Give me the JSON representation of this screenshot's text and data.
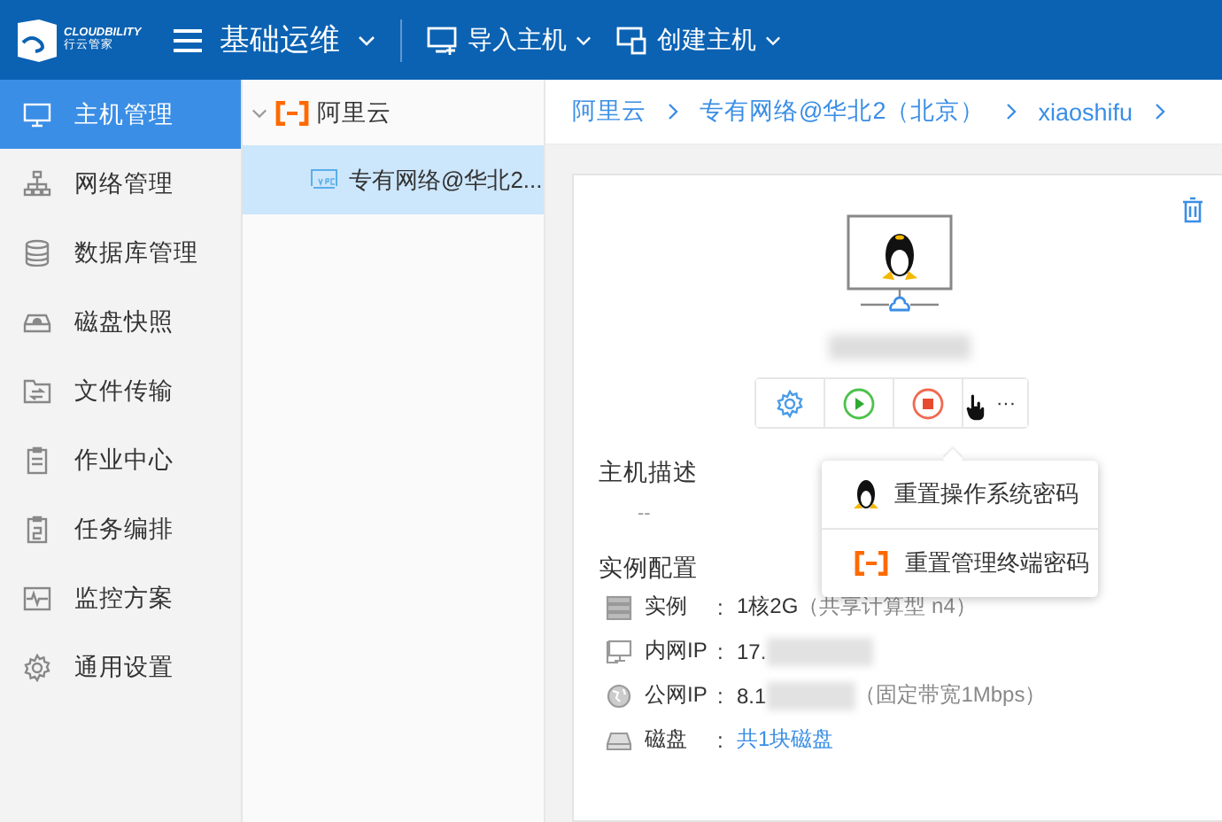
{
  "header": {
    "logo_text": "CLOUDBILITY",
    "logo_subtext": "行云管家",
    "title": "基础运维",
    "actions": [
      {
        "label": "导入主机"
      },
      {
        "label": "创建主机"
      }
    ]
  },
  "sidebar": {
    "items": [
      {
        "label": "主机管理",
        "selected": true
      },
      {
        "label": "网络管理",
        "selected": false
      },
      {
        "label": "数据库管理",
        "selected": false
      },
      {
        "label": "磁盘快照",
        "selected": false
      },
      {
        "label": "文件传输",
        "selected": false
      },
      {
        "label": "作业中心",
        "selected": false
      },
      {
        "label": "任务编排",
        "selected": false
      },
      {
        "label": "监控方案",
        "selected": false
      },
      {
        "label": "通用设置",
        "selected": false
      }
    ]
  },
  "tree": {
    "label": "阿里云",
    "expanded": true,
    "children": [
      {
        "label": "专有网络@华北2...",
        "selected": true
      }
    ]
  },
  "breadcrumb": [
    "阿里云",
    "专有网络@华北2（北京）",
    "xiaoshifu"
  ],
  "host": {
    "more_label": "···",
    "menu": [
      {
        "label": "重置操作系统密码",
        "kind": "os"
      },
      {
        "label": "重置管理终端密码",
        "kind": "terminal"
      }
    ],
    "description_title": "主机描述",
    "description": "--",
    "config_title": "实例配置",
    "config": [
      {
        "label": "实例",
        "separator": ":",
        "value": "1核2G",
        "note": "（共享计算型 n4）",
        "kind": "text"
      },
      {
        "label": "内网IP",
        "separator": ":",
        "value": "17.",
        "kind": "redacted"
      },
      {
        "label": "公网IP",
        "separator": ":",
        "value": "8.1",
        "note": "（固定带宽1Mbps）",
        "kind": "redacted"
      },
      {
        "label": "磁盘",
        "separator": ":",
        "value": "共1块磁盘",
        "kind": "link"
      }
    ]
  }
}
